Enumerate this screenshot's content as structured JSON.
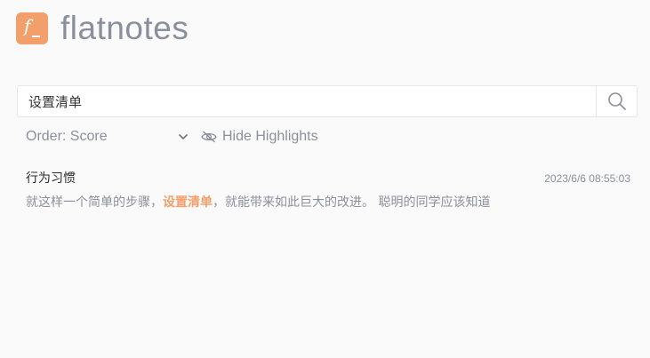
{
  "app": {
    "title": "flatnotes",
    "logo_letter": "f",
    "accent_color": "#f29f6c",
    "text_muted_color": "#8a909b"
  },
  "search": {
    "value": "设置清单",
    "button_icon": "search-icon"
  },
  "controls": {
    "order_label": "Order: Score",
    "order_icon": "chevron-down-icon",
    "highlights_label": "Hide Highlights",
    "highlights_icon": "eye-slash-icon"
  },
  "results": [
    {
      "title": "行为习惯",
      "date": "2023/6/6 08:55:03",
      "snippet_before": "就这样一个简单的步骤，",
      "snippet_highlight": "设置清单",
      "snippet_after": "，就能带来如此巨大的改进。 聪明的同学应该知道"
    }
  ]
}
